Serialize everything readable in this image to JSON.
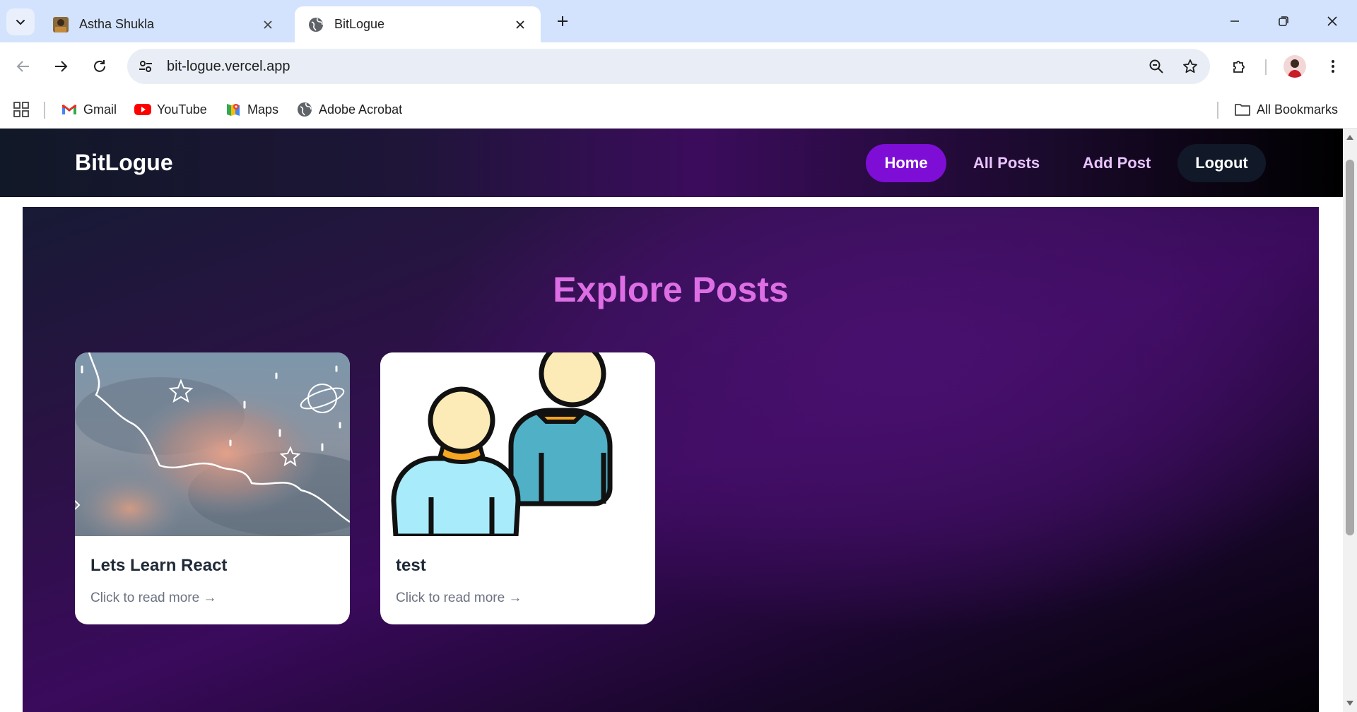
{
  "browser": {
    "tabs": [
      {
        "title": "Astha Shukla",
        "active": false
      },
      {
        "title": "BitLogue",
        "active": true
      }
    ],
    "url": "bit-logue.vercel.app",
    "bookmarks": [
      {
        "label": "Gmail",
        "icon": "gmail-icon"
      },
      {
        "label": "YouTube",
        "icon": "youtube-icon"
      },
      {
        "label": "Maps",
        "icon": "maps-icon"
      },
      {
        "label": "Adobe Acrobat",
        "icon": "globe-icon"
      }
    ],
    "all_bookmarks": "All Bookmarks"
  },
  "site": {
    "brand": "BitLogue",
    "nav": {
      "home": "Home",
      "all_posts": "All Posts",
      "add_post": "Add Post",
      "logout": "Logout"
    },
    "heading": "Explore Posts",
    "posts": [
      {
        "title": "Lets Learn React",
        "more": "Click to read more →",
        "image": "sky-clouds-doodle"
      },
      {
        "title": "test",
        "more": "Click to read more →",
        "image": "two-people-illustration"
      }
    ]
  },
  "colors": {
    "accent_purple": "#7e0ed6",
    "heading_pink": "#dd6ee4",
    "nav_link": "#e9c3ff",
    "tab_strip": "#d3e3fd"
  }
}
